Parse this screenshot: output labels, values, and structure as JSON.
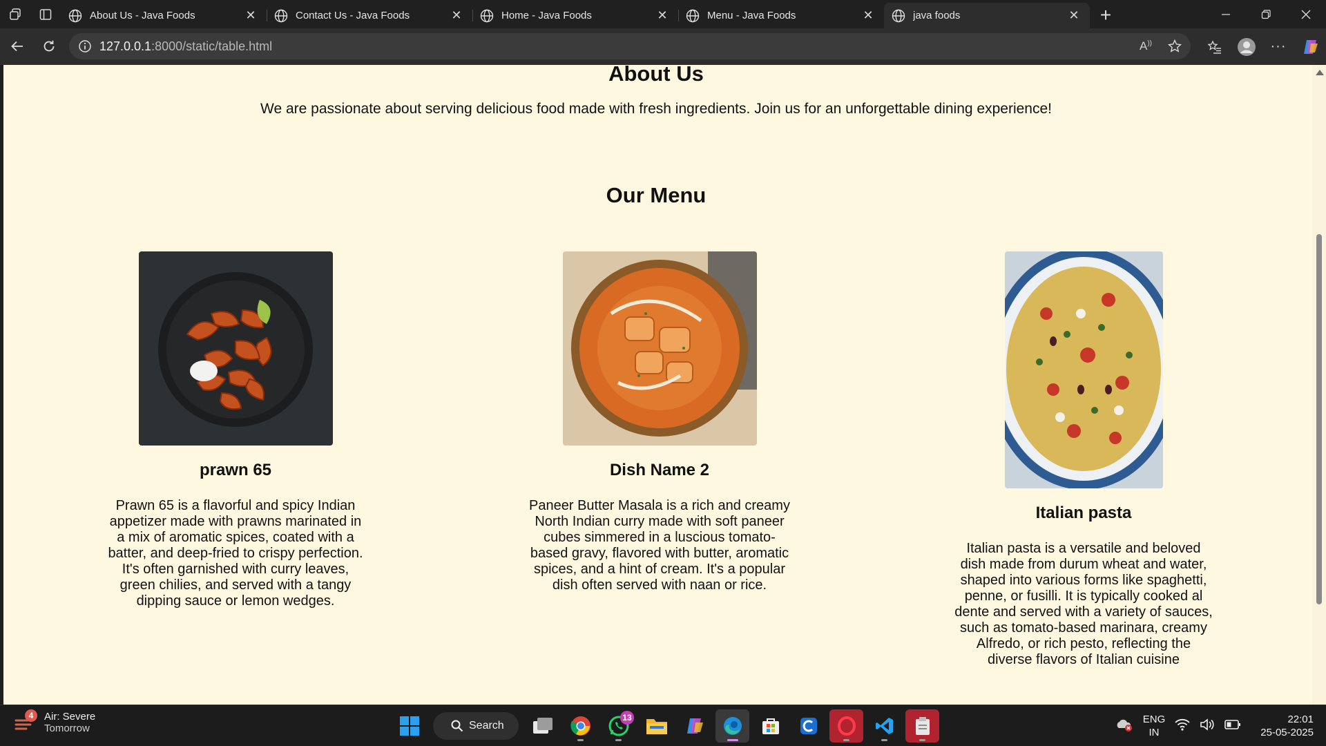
{
  "browser": {
    "tabs": [
      {
        "title": "About Us - Java Foods",
        "active": false
      },
      {
        "title": "Contact Us - Java Foods",
        "active": false
      },
      {
        "title": "Home - Java Foods",
        "active": false
      },
      {
        "title": "Menu - Java Foods",
        "active": false
      },
      {
        "title": "java foods",
        "active": true
      }
    ],
    "address": {
      "host": "127.0.0.1",
      "path": ":8000/static/table.html"
    }
  },
  "page": {
    "about_title": "About Us",
    "about_text": "We are passionate about serving delicious food made with fresh ingredients. Join us for an unforgettable dining experience!",
    "menu_title": "Our Menu",
    "dishes": [
      {
        "name": "prawn 65",
        "image": "prawn-65-photo",
        "description": "Prawn 65 is a flavorful and spicy Indian appetizer made with prawns marinated in a mix of aromatic spices, coated with a batter, and deep-fried to crispy perfection. It's often garnished with curry leaves, green chilies, and served with a tangy dipping sauce or lemon wedges."
      },
      {
        "name": "Dish Name 2",
        "image": "paneer-butter-masala-photo",
        "description": "Paneer Butter Masala is a rich and creamy North Indian curry made with soft paneer cubes simmered in a luscious tomato-based gravy, flavored with butter, aromatic spices, and a hint of cream. It's a popular dish often served with naan or rice."
      },
      {
        "name": "Italian pasta",
        "image": "italian-pasta-photo",
        "description": "Italian pasta is a versatile and beloved dish made from durum wheat and water, shaped into various forms like spaghetti, penne, or fusilli. It is typically cooked al dente and served with a variety of sauces, such as tomato-based marinara, creamy Alfredo, or rich pesto, reflecting the diverse flavors of Italian cuisine"
      }
    ]
  },
  "taskbar": {
    "weather_badge": "4",
    "weather_title": "Air: Severe",
    "weather_sub": "Tomorrow",
    "search_label": "Search",
    "whatsapp_badge": "13",
    "lang_top": "ENG",
    "lang_bottom": "IN",
    "time": "22:01",
    "date": "25-05-2025"
  },
  "colors": {
    "page_bg": "#fff8e1",
    "chrome_dark": "#202020",
    "toolbar": "#2d2d2d"
  }
}
